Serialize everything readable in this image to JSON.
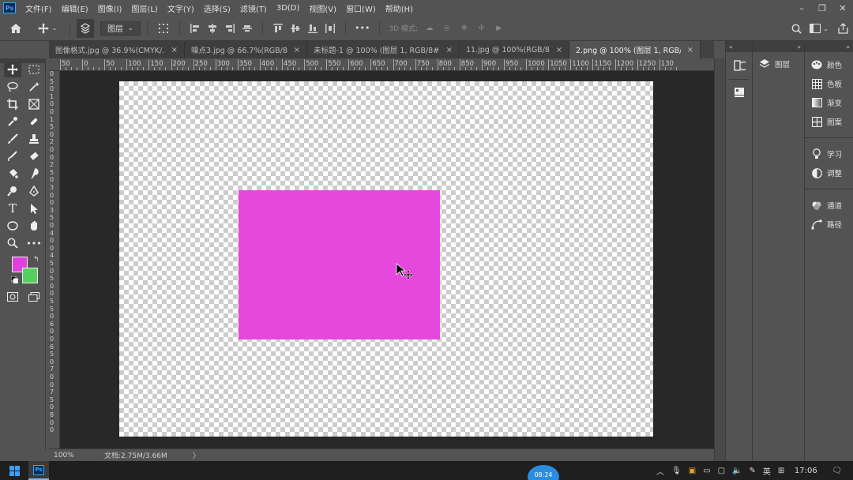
{
  "app": {
    "logo": "Ps"
  },
  "menu": {
    "items": [
      "文件(F)",
      "编辑(E)",
      "图像(I)",
      "图层(L)",
      "文字(Y)",
      "选择(S)",
      "滤镜(T)",
      "3D(D)",
      "视图(V)",
      "窗口(W)",
      "帮助(H)"
    ]
  },
  "window_controls": {
    "minimize": "–",
    "restore": "❐",
    "close": "✕"
  },
  "options_bar": {
    "auto_select_target": "图层",
    "mode_label": "3D 模式:",
    "more": "•••"
  },
  "tabs": [
    {
      "label": "图像格式.jpg @ 36.9%(CMYK/...",
      "active": false
    },
    {
      "label": "噪点3.jpg @ 66.7%(RGB/8...",
      "active": false
    },
    {
      "label": "未标题-1 @ 100% (图层 1, RGB/8#...",
      "active": false
    },
    {
      "label": "11.jpg @ 100%(RGB/8...",
      "active": false
    },
    {
      "label": "2.png @ 100% (图层 1, RGB/8)",
      "active": true
    }
  ],
  "ruler": {
    "top_labels": [
      "50",
      "0",
      "50",
      "100",
      "150",
      "200",
      "250",
      "300",
      "350",
      "400",
      "450",
      "500",
      "550",
      "600",
      "650",
      "700",
      "750",
      "800",
      "850",
      "900",
      "950",
      "1000",
      "1050",
      "1100",
      "1150",
      "1200",
      "1250",
      "130"
    ],
    "left_labels": [
      "0",
      "5",
      "0",
      "1",
      "0",
      "0",
      "1",
      "5",
      "0",
      "2",
      "0",
      "0",
      "2",
      "5",
      "0",
      "3",
      "0",
      "0",
      "3",
      "5",
      "0",
      "4",
      "0",
      "0",
      "4",
      "5",
      "0",
      "5",
      "0",
      "0",
      "5",
      "5",
      "0",
      "6",
      "0",
      "0",
      "6",
      "5",
      "0",
      "7",
      "0",
      "0",
      "7",
      "5",
      "0",
      "8",
      "0",
      "0"
    ]
  },
  "status": {
    "zoom": "100%",
    "doc_size": "文档:2.75M/3.66M",
    "arrow": "〉"
  },
  "colors": {
    "foreground": "#e040e0",
    "background": "#55d060",
    "layer_fill": "#e647dc"
  },
  "layers_panel": {
    "title": "图层"
  },
  "props_panel": {
    "groups": [
      [
        {
          "icon": "palette-icon",
          "label": "颜色"
        },
        {
          "icon": "swatches-icon",
          "label": "色板"
        },
        {
          "icon": "gradient-icon",
          "label": "渐变"
        },
        {
          "icon": "pattern-icon",
          "label": "图案"
        }
      ],
      [
        {
          "icon": "learn-icon",
          "label": "学习"
        },
        {
          "icon": "adjust-icon",
          "label": "调整"
        }
      ],
      [
        {
          "icon": "channels-icon",
          "label": "通道"
        },
        {
          "icon": "paths-icon",
          "label": "路径"
        }
      ]
    ]
  },
  "taskbar": {
    "timer": "08:24",
    "ime": "英",
    "clock": "17:06"
  }
}
